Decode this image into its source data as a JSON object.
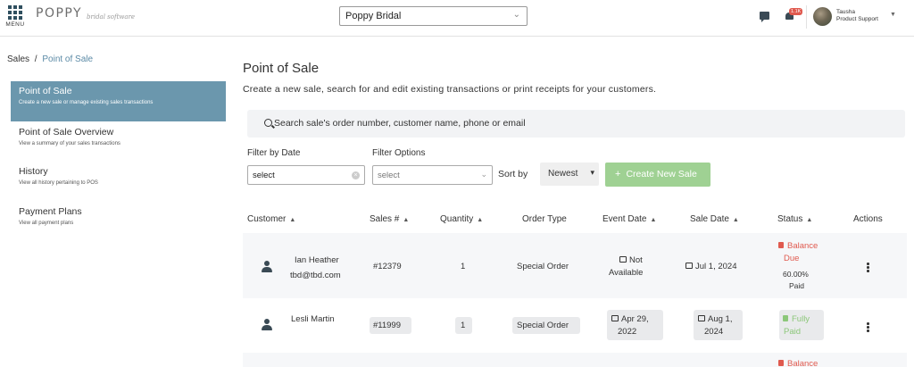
{
  "header": {
    "menu_label": "MENU",
    "logo_text": "POPPY",
    "logo_sub": "bridal software",
    "store_selected": "Poppy Bridal",
    "notification_count": "1.1K",
    "user_name": "Tausha",
    "user_role": "Product Support"
  },
  "breadcrumb": {
    "root": "Sales",
    "sep": "/",
    "current": "Point of Sale"
  },
  "sidebar": {
    "items": [
      {
        "title": "Point of Sale",
        "desc": "Create a new sale or manage existing sales transactions"
      },
      {
        "title": "Point of Sale Overview",
        "desc": "View a summary of your sales transactions"
      },
      {
        "title": "History",
        "desc": "View all history pertaining to POS"
      },
      {
        "title": "Payment Plans",
        "desc": "View all payment plans"
      }
    ]
  },
  "main": {
    "title": "Point of Sale",
    "description": "Create a new sale, search for and edit existing transactions or print receipts for your customers.",
    "search_placeholder": "Search sale's order number, customer name, phone or email",
    "filter_date_label": "Filter by Date",
    "filter_date_value": "select",
    "filter_options_label": "Filter Options",
    "filter_options_value": "select",
    "sort_label": "Sort by",
    "sort_value": "Newest",
    "create_button": "Create New Sale"
  },
  "table": {
    "headers": [
      "Customer",
      "Sales #",
      "Quantity",
      "Order Type",
      "Event Date",
      "Sale Date",
      "Status",
      "Actions"
    ],
    "rows": [
      {
        "name": "Ian Heather",
        "email": "tbd@tbd.com",
        "sales_no": "#12379",
        "quantity": "1",
        "order_type": "Special Order",
        "event_date_1": "Not",
        "event_date_2": "Available",
        "sale_date": "Jul 1, 2024",
        "status_1": "Balance",
        "status_2": "Due",
        "status_pct": "60.00%",
        "status_paid": "Paid"
      },
      {
        "name": "Lesli Martin",
        "sales_no": "#11999",
        "quantity": "1",
        "order_type": "Special Order",
        "event_date_1": "Apr 29,",
        "event_date_2": "2022",
        "sale_date_1": "Aug 1,",
        "sale_date_2": "2024",
        "status_1": "Fully",
        "status_2": "Paid"
      },
      {
        "status_1": "Balance"
      }
    ]
  },
  "colors": {
    "sidebar_active": "#6b97ad",
    "create_button": "#9fd193",
    "balance_due": "#e05a4f",
    "fully_paid": "#8cc77a",
    "link": "#5b8aa6"
  }
}
